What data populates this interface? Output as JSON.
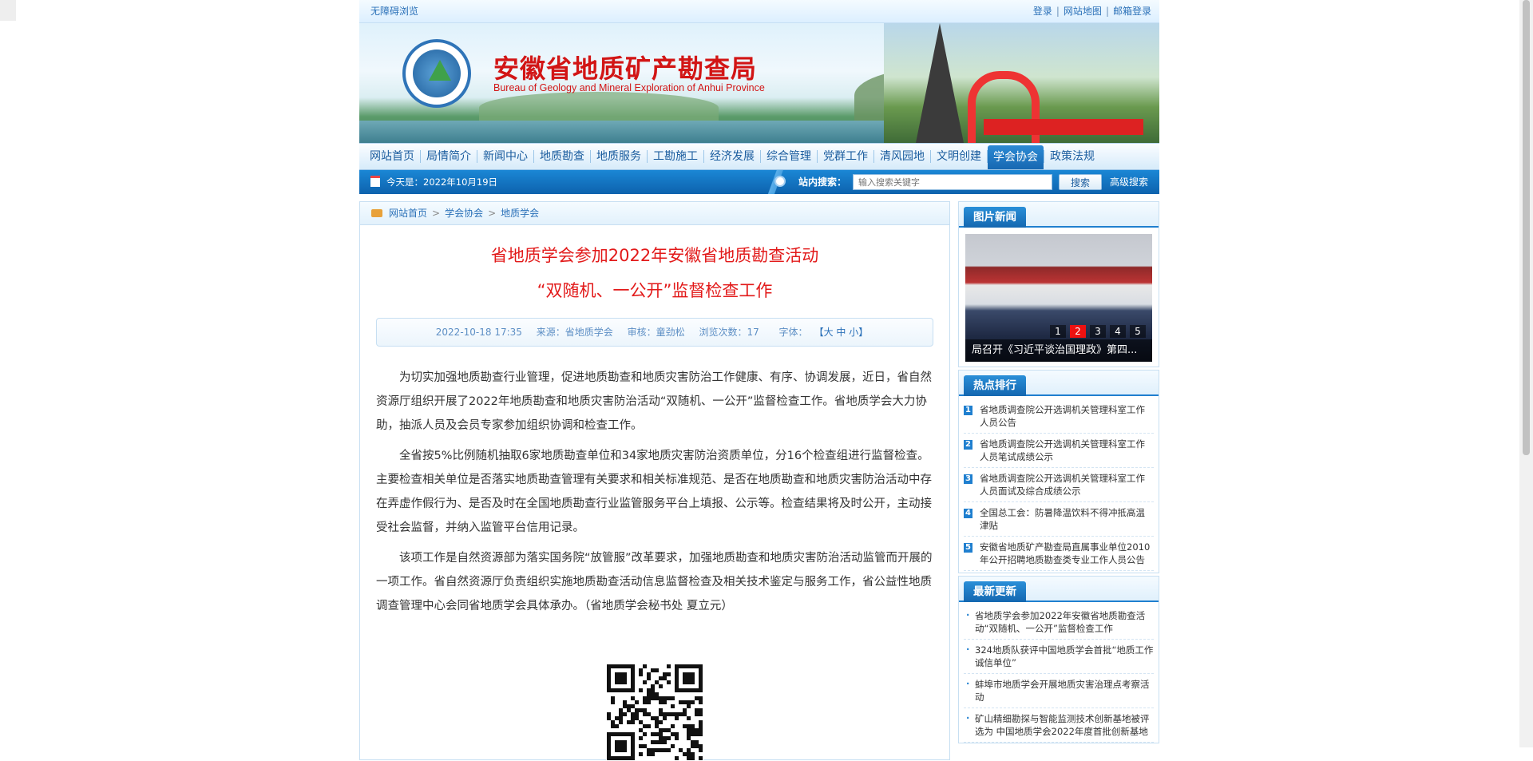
{
  "topbar": {
    "accessibility": "无障碍浏览",
    "links": [
      "登录",
      "网站地图",
      "邮箱登录"
    ]
  },
  "header": {
    "title_cn": "安徽省地质矿产勘查局",
    "title_en": "Bureau of Geology and Mineral Exploration of Anhui Province"
  },
  "nav": {
    "items": [
      "网站首页",
      "局情简介",
      "新闻中心",
      "地质勘查",
      "地质服务",
      "工勘施工",
      "经济发展",
      "综合管理",
      "党群工作",
      "清风园地",
      "文明创建",
      "学会协会",
      "政策法规"
    ],
    "active": "学会协会"
  },
  "infobar": {
    "date": "今天是：2022年10月19日",
    "search_label": "站内搜索：",
    "search_placeholder": "输入搜索关键字",
    "search_button": "搜索",
    "advanced": "高级搜索"
  },
  "breadcrumb": [
    "网站首页",
    "学会协会",
    "地质学会"
  ],
  "article": {
    "title_line1": "省地质学会参加2022年安徽省地质勘查活动",
    "title_line2": "“双随机、一公开”监督检查工作",
    "meta": {
      "datetime": "2022-10-18 17:35",
      "source": "来源：省地质学会",
      "reviewer": "审核：童劲松",
      "views": "浏览次数：17",
      "font_label": "字体：",
      "font_sizes": "【大 中 小】"
    },
    "paragraphs": [
      "为切实加强地质勘查行业管理，促进地质勘查和地质灾害防治工作健康、有序、协调发展，近日，省自然资源厅组织开展了2022年地质勘查和地质灾害防治活动“双随机、一公开”监督检查工作。省地质学会大力协助，抽派人员及会员专家参加组织协调和检查工作。",
      "全省按5%比例随机抽取6家地质勘查单位和34家地质灾害防治资质单位，分16个检查组进行监督检查。主要检查相关单位是否落实地质勘查管理有关要求和相关标准规范、是否在地质勘查和地质灾害防治活动中存在弄虚作假行为、是否及时在全国地质勘查行业监管服务平台上填报、公示等。检查结果将及时公开，主动接受社会监督，并纳入监管平台信用记录。",
      "该项工作是自然资源部为落实国务院“放管服”改革要求，加强地质勘查和地质灾害防治活动监管而开展的一项工作。省自然资源厅负责组织实施地质勘查活动信息监督检查及相关技术鉴定与服务工作，省公益性地质调查管理中心会同省地质学会具体承办。（省地质学会秘书处 夏立元）"
    ]
  },
  "sidebar": {
    "photo_news": {
      "title": "图片新闻",
      "pages": [
        "1",
        "2",
        "3",
        "4",
        "5"
      ],
      "active_page": "2",
      "caption": "局召开《习近平谈治国理政》第四..."
    },
    "hot": {
      "title": "热点排行",
      "items": [
        {
          "no": "1",
          "text": "省地质调查院公开选调机关管理科室工作人员公告"
        },
        {
          "no": "2",
          "text": "省地质调查院公开选调机关管理科室工作人员笔试成绩公示"
        },
        {
          "no": "3",
          "text": "省地质调查院公开选调机关管理科室工作人员面试及综合成绩公示"
        },
        {
          "no": "4",
          "text": "全国总工会：防暑降温饮料不得冲抵高温津贴"
        },
        {
          "no": "5",
          "text": "安徽省地质矿产勘查局直属事业单位2010年公开招聘地质勘查类专业工作人员公告"
        }
      ]
    },
    "latest": {
      "title": "最新更新",
      "items": [
        "省地质学会参加2022年安徽省地质勘查活动“双随机、一公开”监督检查工作",
        "324地质队获评中国地质学会首批“地质工作诚信单位”",
        "蚌埠市地质学会开展地质灾害治理点考察活动",
        "矿山精细勘探与智能监测技术创新基地被评选为 中国地质学会2022年度首批创新基地"
      ]
    }
  }
}
